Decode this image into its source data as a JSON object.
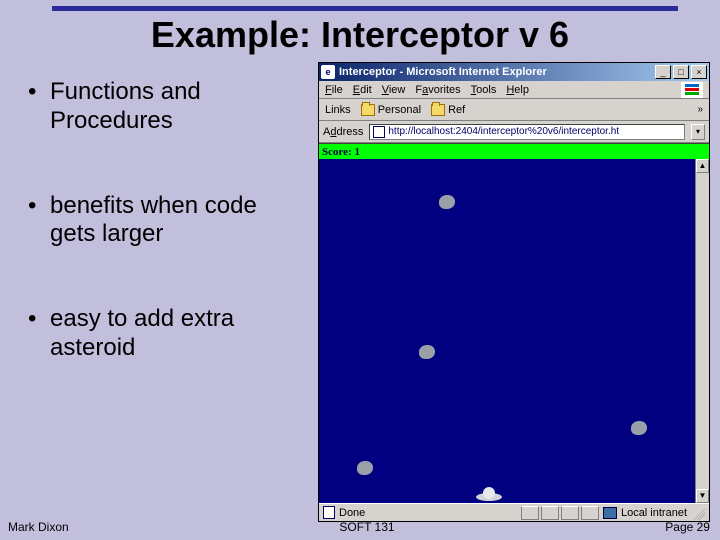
{
  "slide": {
    "title": "Example: Interceptor v 6",
    "bullets": [
      "Functions and Procedures",
      "benefits when code gets larger",
      "easy to add extra asteroid"
    ],
    "footer_left": "Mark Dixon",
    "footer_center": "SOFT 131",
    "footer_right": "Page 29"
  },
  "browser": {
    "title": "Interceptor - Microsoft Internet Explorer",
    "menu": {
      "file": "File",
      "edit": "Edit",
      "view": "View",
      "favorites": "Favorites",
      "tools": "Tools",
      "help": "Help"
    },
    "links_label": "Links",
    "link_personal": "Personal",
    "link_ref": "Ref",
    "more": "»",
    "address_label": "Address",
    "address_value": "http://localhost:2404/interceptor%20v6/interceptor.ht",
    "score_label": "Score: 1",
    "status_done": "Done",
    "status_zone": "Local intranet",
    "win": {
      "min": "_",
      "max": "□",
      "close": "×"
    },
    "dropdown_glyph": "▾",
    "scroll_up": "▲",
    "scroll_down": "▼"
  }
}
